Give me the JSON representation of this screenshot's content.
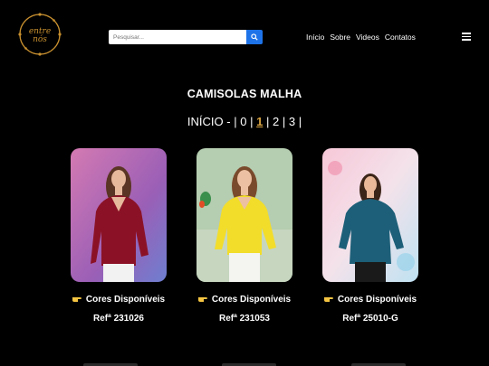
{
  "header": {
    "logo_text": "entre nós",
    "search": {
      "placeholder": "Pesquisar..."
    },
    "nav": [
      "Início",
      "Sobre",
      "Videos",
      "Contatos"
    ],
    "menu_icon": "hamburger-icon"
  },
  "page": {
    "title": "CAMISOLAS MALHA",
    "pagination": {
      "prefix": "INÍCIO -",
      "pages": [
        "0",
        "1",
        "2",
        "3"
      ],
      "current": "1",
      "separator": "|"
    }
  },
  "products": [
    {
      "colors_label": "Cores Disponíveis",
      "ref": "Refª 231026",
      "garment_color": "#8b1226",
      "bg_top": "#c96aa8",
      "bg_bottom": "#7b4fb0"
    },
    {
      "colors_label": "Cores Disponíveis",
      "ref": "Refª 231053",
      "garment_color": "#f2dd2a",
      "bg_top": "#a9c7a0",
      "bg_bottom": "#c2d3b8"
    },
    {
      "colors_label": "Cores Disponíveis",
      "ref": "Refª 25010-G",
      "garment_color": "#1d5f78",
      "bg_top": "#f3c9d8",
      "bg_bottom": "#cfe6f2"
    }
  ],
  "colors": {
    "accent": "#d9a441",
    "search_button": "#1e73e8",
    "background": "#000000"
  }
}
